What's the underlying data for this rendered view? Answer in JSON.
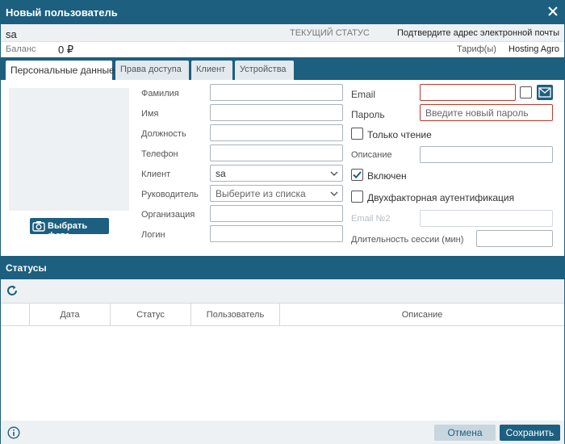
{
  "window": {
    "title": "Новый пользователь"
  },
  "header": {
    "username": "sa",
    "status_label": "ТЕКУЩИЙ СТАТУС",
    "status_value": "Подтвердите адрес электронной почты",
    "balance_label": "Баланс",
    "balance_value": "0 ₽",
    "tariff_label": "Тариф(ы)",
    "tariff_value": "Hosting Agro"
  },
  "tabs": [
    {
      "label": "Персональные данные",
      "active": true
    },
    {
      "label": "Права доступа",
      "active": false
    },
    {
      "label": "Клиент",
      "active": false
    },
    {
      "label": "Устройства",
      "active": false
    }
  ],
  "photo": {
    "button_label": "Выбрать фото"
  },
  "left_fields": {
    "lastname": {
      "label": "Фамилия",
      "value": ""
    },
    "firstname": {
      "label": "Имя",
      "value": ""
    },
    "position": {
      "label": "Должность",
      "value": ""
    },
    "phone": {
      "label": "Телефон",
      "value": ""
    },
    "client": {
      "label": "Клиент",
      "value": "sa"
    },
    "manager": {
      "label": "Руководитель",
      "placeholder": "Выберите из списка"
    },
    "organization": {
      "label": "Организация",
      "value": ""
    },
    "login": {
      "label": "Логин",
      "value": ""
    }
  },
  "right_fields": {
    "email": {
      "label": "Email",
      "value": ""
    },
    "password": {
      "label": "Пароль",
      "placeholder": "Введите новый пароль"
    },
    "readonly": {
      "label": "Только чтение",
      "checked": false
    },
    "description": {
      "label": "Описание",
      "value": ""
    },
    "enabled": {
      "label": "Включен",
      "checked": true
    },
    "twofactor": {
      "label": "Двухфакторная аутентификация",
      "checked": false
    },
    "email2": {
      "label": "Email №2",
      "value": ""
    },
    "session": {
      "label": "Длительность сессии (мин)",
      "value": ""
    }
  },
  "statuses": {
    "title": "Статусы",
    "columns": [
      "",
      "Дата",
      "Статус",
      "Пользователь",
      "Описание"
    ]
  },
  "footer": {
    "cancel_label": "Отмена",
    "save_label": "Сохранить"
  },
  "colors": {
    "primary": "#1d5f7f",
    "error_border": "#c0392b",
    "panel_bg": "#eef1f3"
  }
}
